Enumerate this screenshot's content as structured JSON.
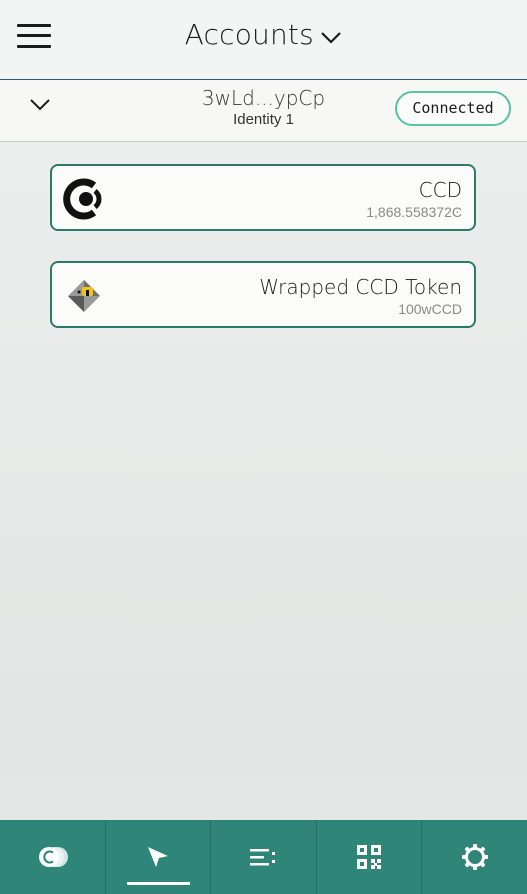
{
  "header": {
    "title": "Accounts",
    "menu_icon": "hamburger-menu-icon",
    "title_chevron_icon": "chevron-down-icon"
  },
  "account": {
    "address": "3wLd...ypCp",
    "identity": "Identity 1",
    "status": "Connected",
    "expand_icon": "chevron-down-icon"
  },
  "tokens": [
    {
      "name": "CCD",
      "amount": "1,868.558372Ͼ",
      "icon": "ccd-logo-icon"
    },
    {
      "name": "Wrapped CCD Token",
      "amount": "100wCCD",
      "icon": "wccd-token-icon"
    }
  ],
  "nav": {
    "items": [
      {
        "icon": "tokens-icon",
        "active": false
      },
      {
        "icon": "send-icon",
        "active": true
      },
      {
        "icon": "transaction-list-icon",
        "active": false
      },
      {
        "icon": "qr-code-icon",
        "active": false
      },
      {
        "icon": "settings-gear-icon",
        "active": false
      }
    ]
  },
  "colors": {
    "accent": "#2f8577",
    "connected_border": "#58c2a3",
    "card_border": "#2d7a6b"
  }
}
